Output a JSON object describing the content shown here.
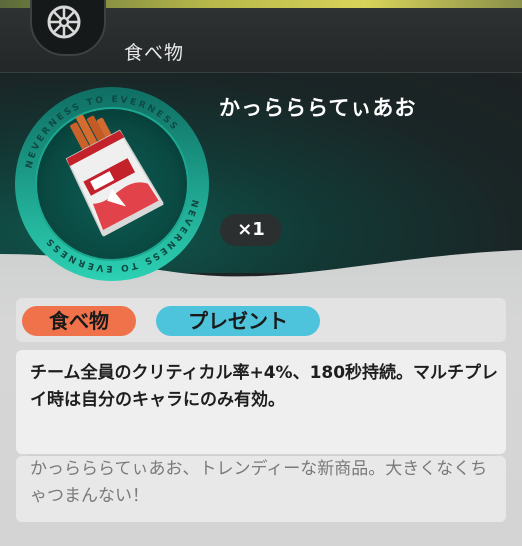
{
  "header": {
    "category_title": "食べ物"
  },
  "item": {
    "name": "かっらららてぃあお",
    "count": "×1",
    "medallion_text": "NEVERNESS TO EVERNESS"
  },
  "tags": {
    "category": "食べ物",
    "usage": "プレゼント"
  },
  "description": {
    "effect": "チーム全員のクリティカル率+4%、180秒持続。マルチプレイ時は自分のキャラにのみ有効。",
    "flavor": "かっらららてぃあお、トレンディーな新商品。大きくなくちゃつまんない！"
  },
  "colors": {
    "tag_food": "#f0724a",
    "tag_present": "#4ec3dc",
    "medallion_teal": "#1fb9a2"
  },
  "icons": {
    "tab_icon": "wheel-icon",
    "item_image": "snack-bag-icon"
  }
}
